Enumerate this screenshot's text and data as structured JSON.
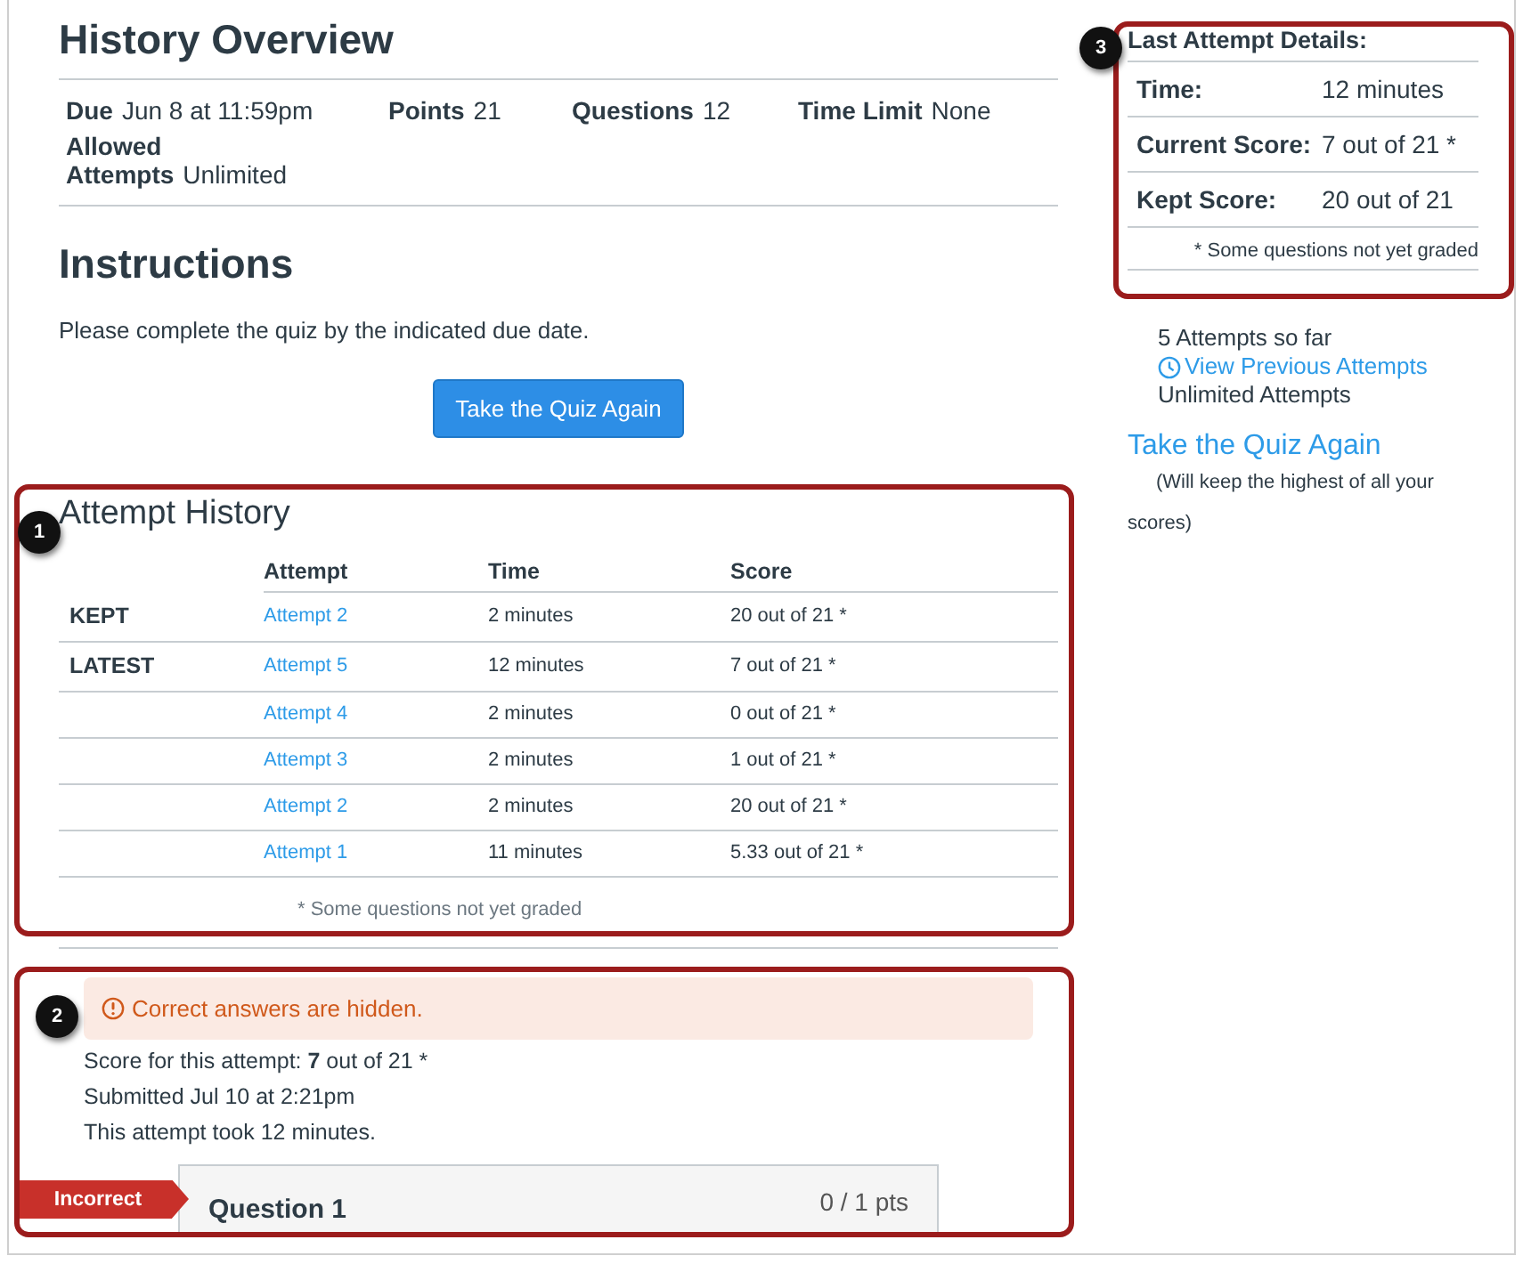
{
  "overview": {
    "title": "History Overview"
  },
  "details": [
    {
      "label": "Due",
      "value": "Jun 8 at 11:59pm"
    },
    {
      "label": "Points",
      "value": "21"
    },
    {
      "label": "Questions",
      "value": "12"
    },
    {
      "label": "Time Limit",
      "value": "None"
    },
    {
      "label": "Allowed Attempts",
      "value": "Unlimited"
    }
  ],
  "instructions": {
    "title": "Instructions",
    "text": "Please complete the quiz by the indicated due date."
  },
  "retake_button": "Take the Quiz Again",
  "attempt_history": {
    "callout": "1",
    "title": "Attempt History",
    "columns": [
      "Attempt",
      "Time",
      "Score"
    ],
    "rows": [
      {
        "tag": "KEPT",
        "attempt": "Attempt 2",
        "time": "2 minutes",
        "score": "20 out of 21 *"
      },
      {
        "tag": "LATEST",
        "attempt": "Attempt 5",
        "time": "12 minutes",
        "score": "7 out of 21 *"
      },
      {
        "attempt": "Attempt 4",
        "time": "2 minutes",
        "score": "0 out of 21 *"
      },
      {
        "attempt": "Attempt 3",
        "time": "2 minutes",
        "score": "1 out of 21 *"
      },
      {
        "attempt": "Attempt 2",
        "time": "2 minutes",
        "score": "20 out of 21 *"
      },
      {
        "attempt": "Attempt 1",
        "time": "11 minutes",
        "score": "5.33 out of 21 *"
      }
    ],
    "note": "* Some questions not yet graded"
  },
  "attempt_result": {
    "callout": "2",
    "alert": "Correct answers are hidden.",
    "score_line": "Score for this attempt: **7** out of 21 *",
    "submitted": "Submitted Jul 10 at 2:21pm",
    "duration": "This attempt took 12 minutes.",
    "question": {
      "status": "Incorrect",
      "title": "Question 1",
      "points": "0 / 1 pts"
    }
  },
  "sidebar": {
    "callout": "3",
    "title": "Last Attempt Details:",
    "rows": [
      {
        "label": "Time:",
        "value": "12 minutes"
      },
      {
        "label": "Current Score:",
        "value": "7 out of 21 *"
      },
      {
        "label": "Kept Score:",
        "value": "20 out of 21"
      }
    ],
    "note": "* Some questions not yet graded",
    "attempts_count": "5 Attempts so far",
    "view_link": "View Previous Attempts",
    "allowed": "Unlimited Attempts",
    "retake_link": "Take the Quiz Again",
    "retake_note": "(Will keep the highest of all your scores)"
  }
}
